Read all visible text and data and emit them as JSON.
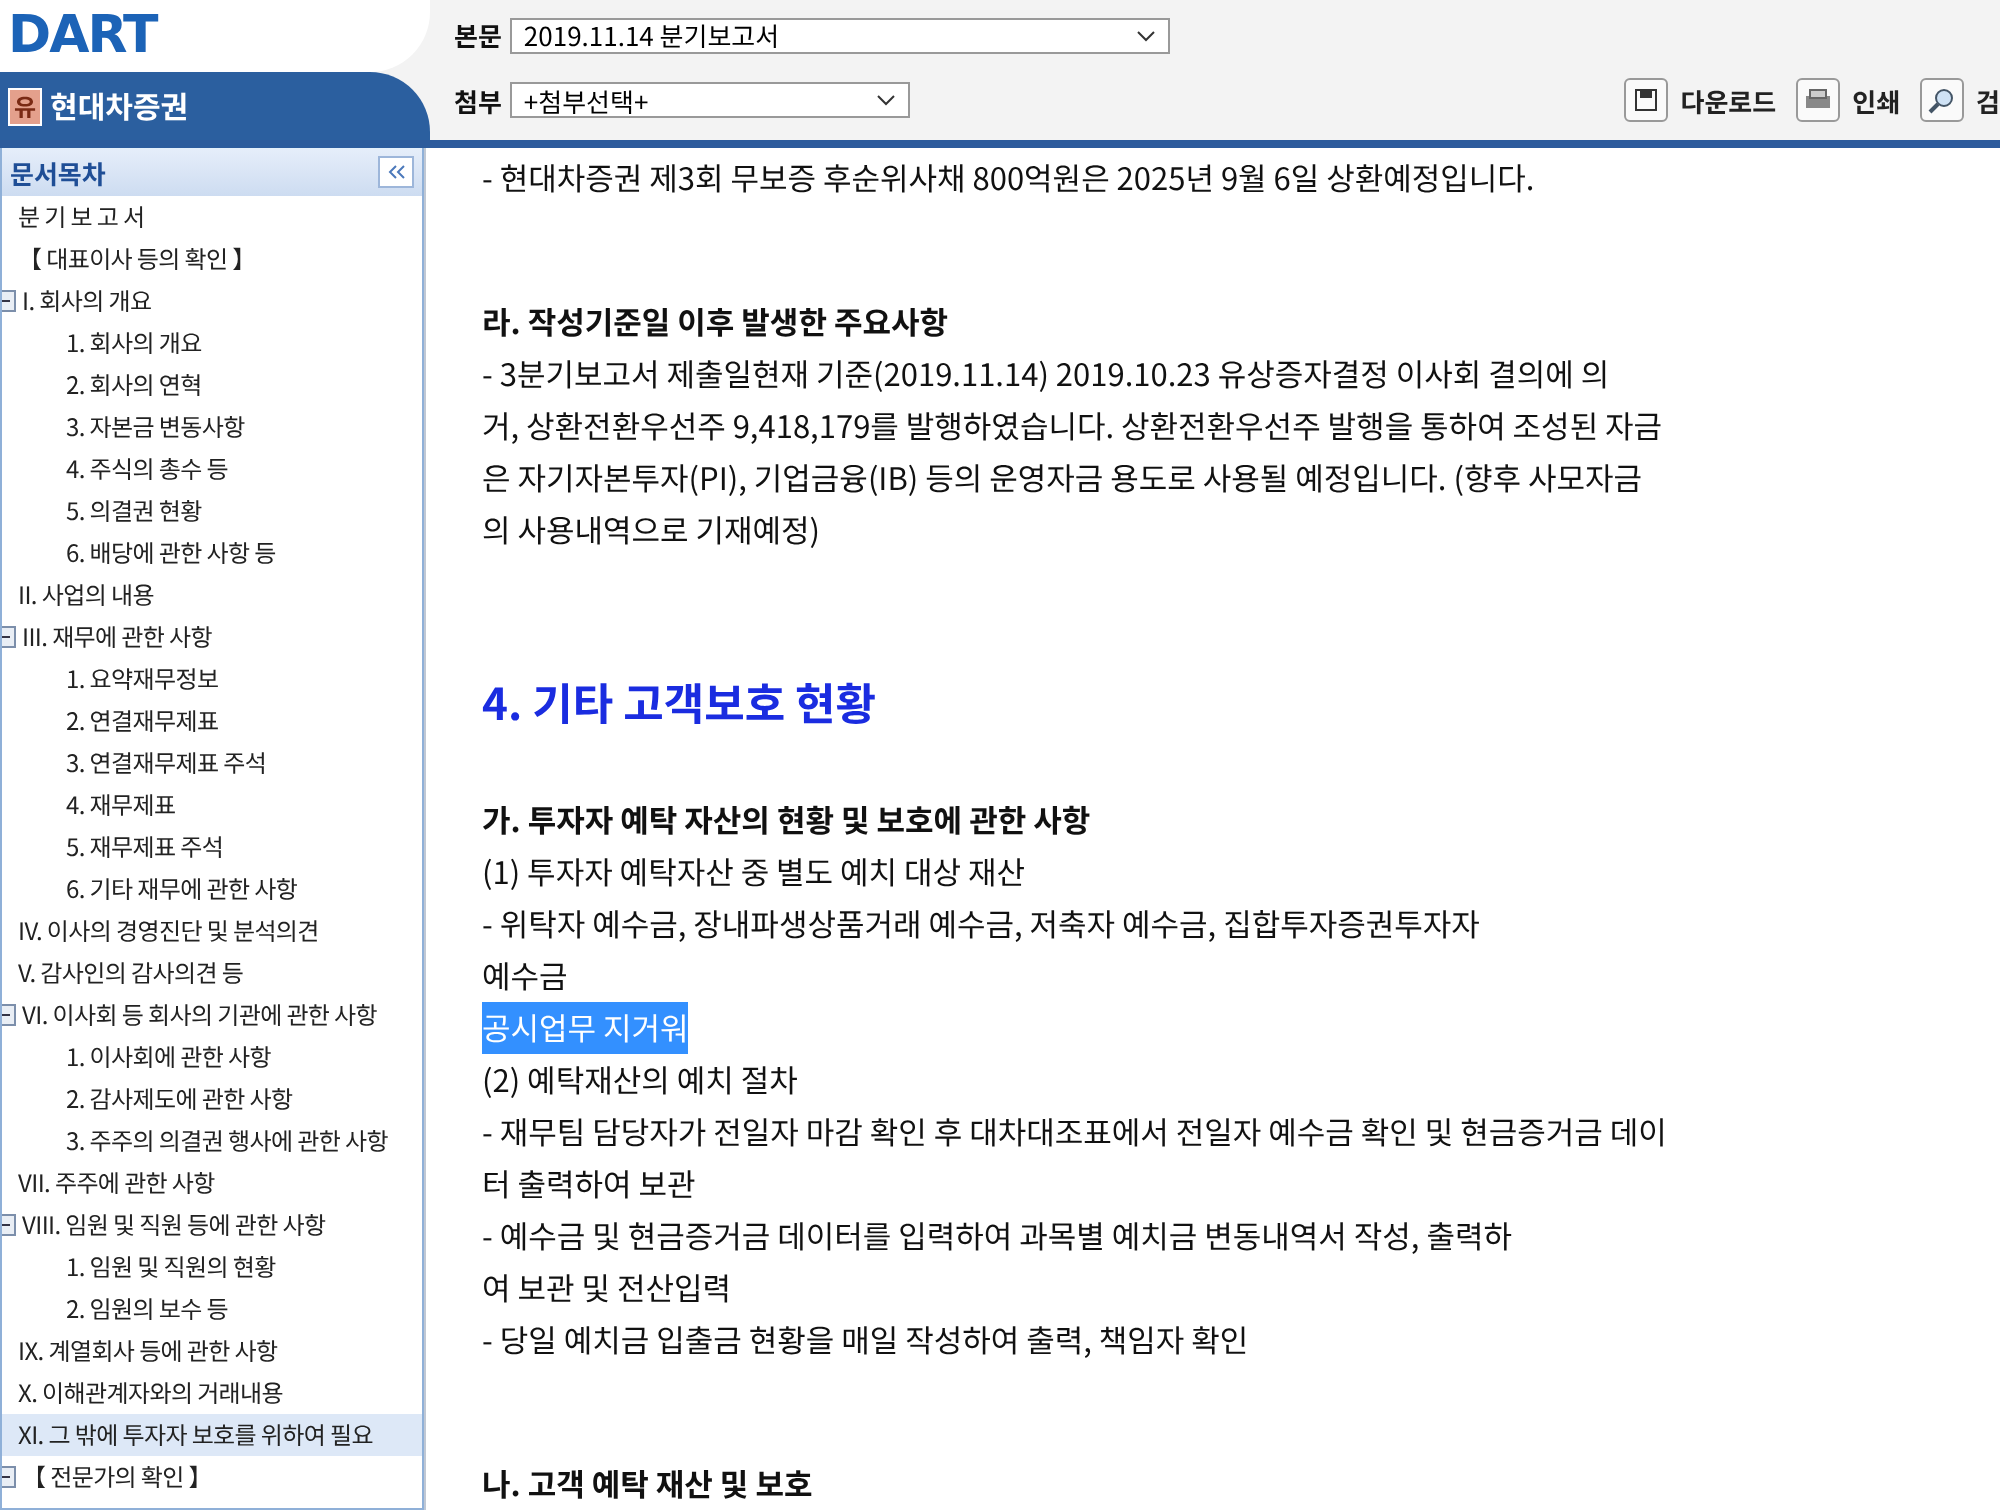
{
  "header": {
    "logo": "DART",
    "company": "현대차증권",
    "company_badge": "유",
    "main_doc": {
      "label": "본문",
      "value": "2019.11.14  분기보고서"
    },
    "attachment": {
      "label": "첨부",
      "value": "+첨부선택+"
    },
    "actions": [
      {
        "kind": "download",
        "label": "다운로드"
      },
      {
        "kind": "print",
        "label": "인쇄"
      },
      {
        "kind": "search",
        "label": "검"
      }
    ]
  },
  "sidebar": {
    "title": "문서목차",
    "items": [
      {
        "label": "분 기 보 고 서",
        "selected": false
      },
      {
        "label": "【 대표이사 등의 확인 】",
        "selected": false
      },
      {
        "label": "I. 회사의 개요",
        "selected": false,
        "expanded": true,
        "children": [
          {
            "label": "1. 회사의 개요",
            "selected": false
          },
          {
            "label": "2. 회사의 연혁",
            "selected": false
          },
          {
            "label": "3. 자본금 변동사항",
            "selected": false
          },
          {
            "label": "4. 주식의 총수 등",
            "selected": false
          },
          {
            "label": "5. 의결권 현황",
            "selected": false
          },
          {
            "label": "6. 배당에 관한 사항 등",
            "selected": false
          }
        ]
      },
      {
        "label": "II. 사업의 내용",
        "selected": false
      },
      {
        "label": "III. 재무에 관한 사항",
        "selected": false,
        "expanded": true,
        "children": [
          {
            "label": "1. 요약재무정보",
            "selected": false
          },
          {
            "label": "2. 연결재무제표",
            "selected": false
          },
          {
            "label": "3. 연결재무제표 주석",
            "selected": false
          },
          {
            "label": "4. 재무제표",
            "selected": false
          },
          {
            "label": "5. 재무제표 주석",
            "selected": false
          },
          {
            "label": "6. 기타 재무에 관한 사항",
            "selected": false
          }
        ]
      },
      {
        "label": "IV. 이사의 경영진단 및 분석의견",
        "selected": false
      },
      {
        "label": "V. 감사인의 감사의견 등",
        "selected": false
      },
      {
        "label": "VI. 이사회 등 회사의 기관에 관한 사항",
        "selected": false,
        "expanded": true,
        "children": [
          {
            "label": "1. 이사회에 관한 사항",
            "selected": false
          },
          {
            "label": "2. 감사제도에 관한 사항",
            "selected": false
          },
          {
            "label": "3. 주주의 의결권 행사에 관한 사항",
            "selected": false
          }
        ]
      },
      {
        "label": "VII. 주주에 관한 사항",
        "selected": false
      },
      {
        "label": "VIII. 임원 및 직원 등에 관한 사항",
        "selected": false,
        "expanded": true,
        "children": [
          {
            "label": "1. 임원 및 직원의 현황",
            "selected": false
          },
          {
            "label": "2. 임원의 보수 등",
            "selected": false
          }
        ]
      },
      {
        "label": "IX. 계열회사 등에 관한 사항",
        "selected": false
      },
      {
        "label": "X. 이해관계자와의 거래내용",
        "selected": false
      },
      {
        "label": "XI. 그 밖에 투자자 보호를 위하여 필요",
        "selected": true
      },
      {
        "label": "【 전문가의 확인 】",
        "selected": false,
        "expanded": true
      }
    ]
  },
  "document": [
    {
      "kind": "text",
      "text": "- 현대차증권 제3회 무보증 후순위사채 800억원은 2025년 9월 6일 상환예정입니다."
    },
    {
      "kind": "gap"
    },
    {
      "kind": "subheading",
      "text": "라. 작성기준일 이후 발생한 주요사항"
    },
    {
      "kind": "text",
      "text": "-   3분기보고서 제출일현재 기준(2019.11.14)  2019.10.23 유상증자결정 이사회 결의에 의"
    },
    {
      "kind": "text",
      "text": "거, 상환전환우선주 9,418,179를 발행하였습니다. 상환전환우선주 발행을 통하여 조성된 자금"
    },
    {
      "kind": "text",
      "text": "은 자기자본투자(PI), 기업금융(IB)  등의 운영자금 용도로 사용될 예정입니다. (향후 사모자금"
    },
    {
      "kind": "text",
      "text": "의 사용내역으로 기재예정)"
    },
    {
      "kind": "gap"
    },
    {
      "kind": "heading",
      "text": "4. 기타 고객보호 현황"
    },
    {
      "kind": "subheading",
      "text": "가. 투자자 예탁 자산의 현황 및 보호에 관한 사항"
    },
    {
      "kind": "text",
      "text": "(1) 투자자 예탁자산 중 별도 예치 대상 재산"
    },
    {
      "kind": "text",
      "text": "- 위탁자 예수금, 장내파생상품거래 예수금, 저축자 예수금, 집합투자증권투자자"
    },
    {
      "kind": "text",
      "text": "예수금"
    },
    {
      "kind": "highlight",
      "text": "공시업무 지거워"
    },
    {
      "kind": "text",
      "text": "(2) 예탁재산의 예치 절차"
    },
    {
      "kind": "text",
      "text": "- 재무팀 담당자가 전일자 마감 확인 후 대차대조표에서 전일자 예수금 확인 및 현금증거금 데이"
    },
    {
      "kind": "text",
      "text": "터 출력하여 보관"
    },
    {
      "kind": "text",
      "text": "- 예수금 및 현금증거금 데이터를 입력하여 과목별 예치금 변동내역서 작성, 출력하"
    },
    {
      "kind": "text",
      "text": "여 보관 및 전산입력"
    },
    {
      "kind": "text",
      "text": "- 당일 예치금 입출금 현황을 매일 작성하여 출력, 책임자 확인"
    },
    {
      "kind": "gap"
    },
    {
      "kind": "subheading",
      "text": "나. 고객 예탁 재산 및 보호"
    }
  ]
}
